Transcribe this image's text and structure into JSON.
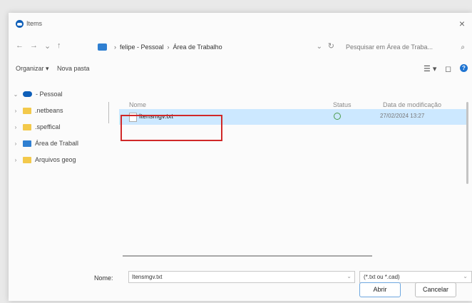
{
  "window": {
    "title": "Items",
    "close_glyph": "×"
  },
  "navbar": {
    "back": "←",
    "forward": "→",
    "recent": "⌄",
    "up": "↑",
    "breadcrumb": [
      "felipe - Pessoal",
      "Área de Trabalho"
    ],
    "breadcrumb_sep": "›",
    "dropdown_glyph": "⌄",
    "refresh_glyph": "↻",
    "search_placeholder": "Pesquisar em Área de Traba...",
    "search_icon": "search-icon"
  },
  "commands": {
    "organize": "Organizar ▾",
    "new_folder": "Nova pasta",
    "view_glyph": "☰ ▾",
    "pane_glyph": "◻",
    "help_glyph": "?"
  },
  "sidebar": {
    "items": [
      {
        "label": "- Pessoal",
        "chevron": "⌄",
        "icon": "cloud-icon"
      },
      {
        "label": ".netbeans",
        "chevron": "›",
        "icon": "folder-icon"
      },
      {
        "label": ".speffical",
        "chevron": "›",
        "icon": "folder-icon"
      },
      {
        "label": "Área de Traball",
        "chevron": "›",
        "icon": "desktop-folder-icon"
      },
      {
        "label": "Arquivos geog",
        "chevron": "›",
        "icon": "folder-icon"
      }
    ]
  },
  "filelist": {
    "columns": {
      "name": "Nome",
      "status": "Status",
      "modified": "Data de modificação"
    },
    "rows": [
      {
        "name": "Itensmgv.txt",
        "modified": "27/02/2024 13:27"
      }
    ]
  },
  "footer": {
    "name_label": "Nome:",
    "name_value": "Itensmgv.txt",
    "filter_value": "(*.txt ou *.cad)",
    "dropdown_glyph": "⌄",
    "open_label": "Abrir",
    "cancel_label": "Cancelar"
  },
  "colors": {
    "selection": "#cce8ff",
    "highlight_box": "#d02828",
    "accent": "#1f74d1"
  }
}
